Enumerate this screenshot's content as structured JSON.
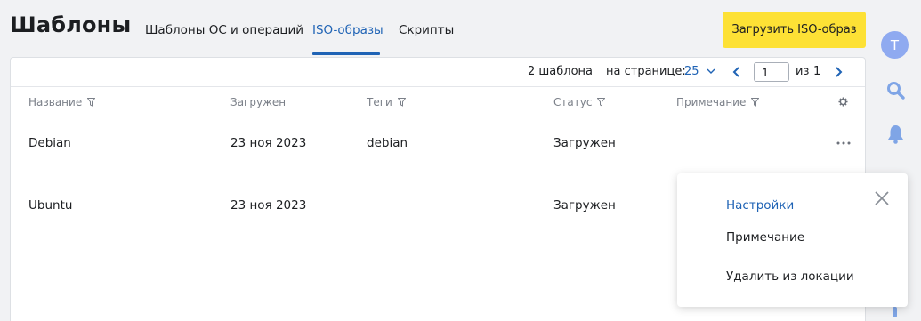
{
  "page": {
    "title": "Шаблоны"
  },
  "tabs": [
    {
      "label": "Шаблоны ОС и операций"
    },
    {
      "label": "ISO-образы",
      "active": true
    },
    {
      "label": "Скрипты"
    }
  ],
  "upload_button": {
    "label": "Загрузить ISO-образ"
  },
  "pagination": {
    "count_text": "2 шаблона",
    "per_page_label": "на странице:",
    "per_page_value": "25",
    "current_page": "1",
    "of_label": "из",
    "total_pages": "1"
  },
  "table": {
    "columns": [
      {
        "label": "Название"
      },
      {
        "label": "Загружен"
      },
      {
        "label": "Теги"
      },
      {
        "label": "Статус"
      },
      {
        "label": "Примечание"
      }
    ],
    "rows": [
      {
        "name": "Debian",
        "uploaded": "23 ноя 2023",
        "tags": "debian",
        "status": "Загружен",
        "note": ""
      },
      {
        "name": "Ubuntu",
        "uploaded": "23 ноя 2023",
        "tags": "",
        "status": "Загружен",
        "note": ""
      }
    ]
  },
  "context_menu": {
    "items": [
      {
        "label": "Настройки",
        "active": true
      },
      {
        "label": "Примечание"
      },
      {
        "label": "Удалить из локации"
      }
    ]
  },
  "user": {
    "initial": "T"
  },
  "colors": {
    "accent": "#1f63b5",
    "button": "#fde135",
    "avatar": "#8faaf0",
    "icons": "#7fa5e6"
  },
  "icons": [
    "filter-icon",
    "gear-icon",
    "more-icon",
    "close-icon",
    "chevron-left-icon",
    "chevron-right-icon",
    "chevron-down-icon",
    "search-icon",
    "bell-icon"
  ]
}
